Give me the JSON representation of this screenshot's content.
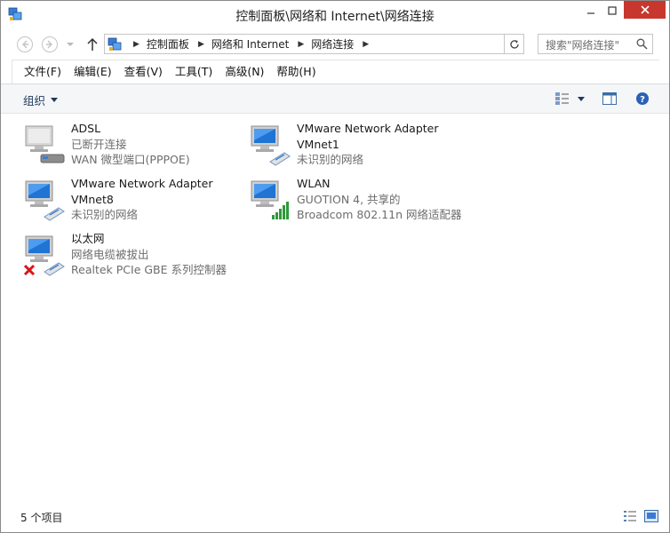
{
  "window": {
    "title": "控制面板\\网络和 Internet\\网络连接"
  },
  "address": {
    "crumbs": [
      "控制面板",
      "网络和 Internet",
      "网络连接"
    ],
    "search_placeholder": "搜索\"网络连接\""
  },
  "menu": {
    "items": [
      "文件(F)",
      "编辑(E)",
      "查看(V)",
      "工具(T)",
      "高级(N)",
      "帮助(H)"
    ]
  },
  "commandbar": {
    "organize_label": "组织"
  },
  "connections": [
    {
      "name": "ADSL",
      "line2": "已断开连接",
      "line3": "WAN 微型端口(PPPOE)",
      "icon": "dialup-adapter-icon"
    },
    {
      "name": "VMware Network Adapter",
      "line2": "VMnet1",
      "line3": "未识别的网络",
      "icon": "ethernet-adapter-icon"
    },
    {
      "name": "VMware Network Adapter",
      "line2": "VMnet8",
      "line3": "未识别的网络",
      "icon": "ethernet-adapter-icon"
    },
    {
      "name": "WLAN",
      "line2": "GUOTION  4, 共享的",
      "line3": "Broadcom 802.11n 网络适配器",
      "icon": "wireless-adapter-icon"
    },
    {
      "name": "以太网",
      "line2": "网络电缆被拔出",
      "line3": "Realtek PCIe GBE 系列控制器",
      "icon": "ethernet-disconnected-icon"
    }
  ],
  "status": {
    "item_count": "5 个项目"
  },
  "colors": {
    "close_button": "#c7372d",
    "secondary_text": "#6d6d6d",
    "organize_text": "#1e395b",
    "commandbar_bg": "#f5f6f7",
    "wifi_green": "#2e9a3a",
    "error_red": "#d9141b"
  }
}
